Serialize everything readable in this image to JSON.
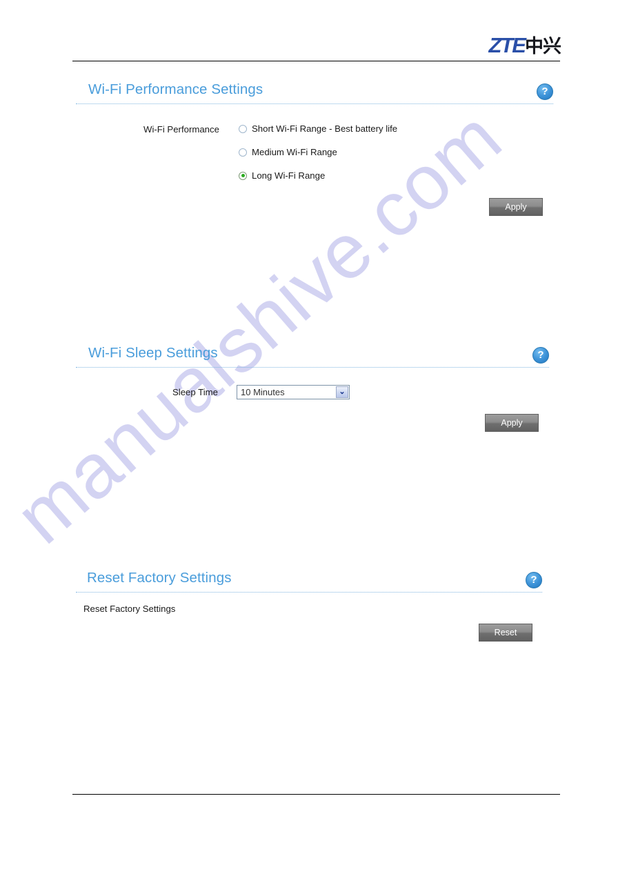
{
  "brand": {
    "logo_latin": "ZTE",
    "logo_cjk": "中兴"
  },
  "watermark": {
    "text": "manualshive.com"
  },
  "sections": [
    {
      "title": "Wi-Fi Performance Settings",
      "help_label": "?",
      "field_label": "Wi-Fi Performance",
      "options": [
        {
          "label": "Short Wi-Fi Range - Best battery life",
          "selected": false
        },
        {
          "label": "Medium Wi-Fi Range",
          "selected": false
        },
        {
          "label": "Long Wi-Fi Range",
          "selected": true
        }
      ],
      "button_label": "Apply"
    },
    {
      "title": "Wi-Fi Sleep Settings",
      "help_label": "?",
      "field_label": "Sleep Time",
      "select_value": "10 Minutes",
      "select_arrow": "⌄",
      "button_label": "Apply"
    },
    {
      "title": "Reset Factory Settings",
      "help_label": "?",
      "body_text": "Reset Factory Settings",
      "button_label": "Reset"
    }
  ],
  "colors": {
    "title_blue": "#4a9ddb",
    "help_blue": "#3d93d8",
    "radio_green": "#2bab1f",
    "button_grey": "#8c8c8c",
    "watermark_lavender": "#ccccf0"
  }
}
